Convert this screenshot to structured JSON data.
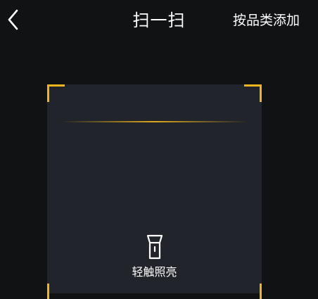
{
  "header": {
    "title": "扫一扫",
    "action_label": "按品类添加"
  },
  "icons": {
    "back": "chevron-left-icon",
    "torch": "flashlight-icon"
  },
  "scanner": {
    "torch_label": "轻触照亮"
  },
  "colors": {
    "background": "#101214",
    "frame": "#21242a",
    "accent": "#f0b51c",
    "text": "#ffffff"
  }
}
